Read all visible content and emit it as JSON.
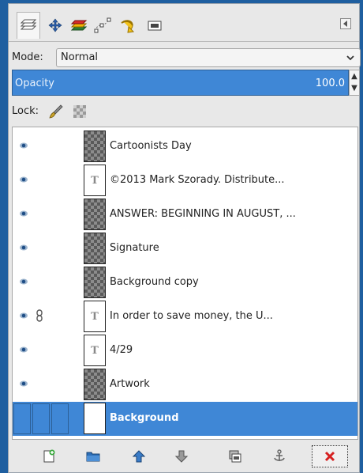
{
  "dialog": {
    "tabs": [
      {
        "icon": "layers-icon"
      },
      {
        "icon": "channels-icon"
      },
      {
        "icon": "paths-icon"
      },
      {
        "icon": "undo-history-icon"
      },
      {
        "icon": "undo-icon"
      },
      {
        "icon": "images-icon"
      }
    ],
    "config_icon": "configure-tab-icon"
  },
  "mode": {
    "label": "Mode:",
    "value": "Normal"
  },
  "opacity": {
    "label": "Opacity",
    "value": "100.0"
  },
  "lock": {
    "label": "Lock:"
  },
  "layers": [
    {
      "name": "Cartoonists Day",
      "thumb": "checker",
      "visible": true,
      "chained": false
    },
    {
      "name": "©2013 Mark Szorady. Distribute...",
      "thumb": "text",
      "visible": true,
      "chained": false
    },
    {
      "name": "ANSWER:  BEGINNING IN AUGUST, ...",
      "thumb": "checker",
      "visible": true,
      "chained": false
    },
    {
      "name": "Signature",
      "thumb": "checker",
      "visible": true,
      "chained": false
    },
    {
      "name": "Background copy",
      "thumb": "checker",
      "visible": true,
      "chained": false
    },
    {
      "name": " In order to save money, the U...",
      "thumb": "text",
      "visible": true,
      "chained": true
    },
    {
      "name": "4/29",
      "thumb": "text",
      "visible": true,
      "chained": false
    },
    {
      "name": "Artwork",
      "thumb": "checker",
      "visible": true,
      "chained": false
    },
    {
      "name": "Background",
      "thumb": "white",
      "visible": false,
      "chained": false,
      "selected": true
    }
  ],
  "toolbar": [
    {
      "icon": "new-layer-icon"
    },
    {
      "icon": "new-layer-group-icon"
    },
    {
      "icon": "raise-layer-icon"
    },
    {
      "icon": "lower-layer-icon"
    },
    {
      "icon": "duplicate-layer-icon"
    },
    {
      "icon": "anchor-layer-icon"
    },
    {
      "icon": "delete-layer-icon"
    }
  ],
  "colors": {
    "selection": "#3f87d6",
    "frame": "#1f5fa0"
  }
}
